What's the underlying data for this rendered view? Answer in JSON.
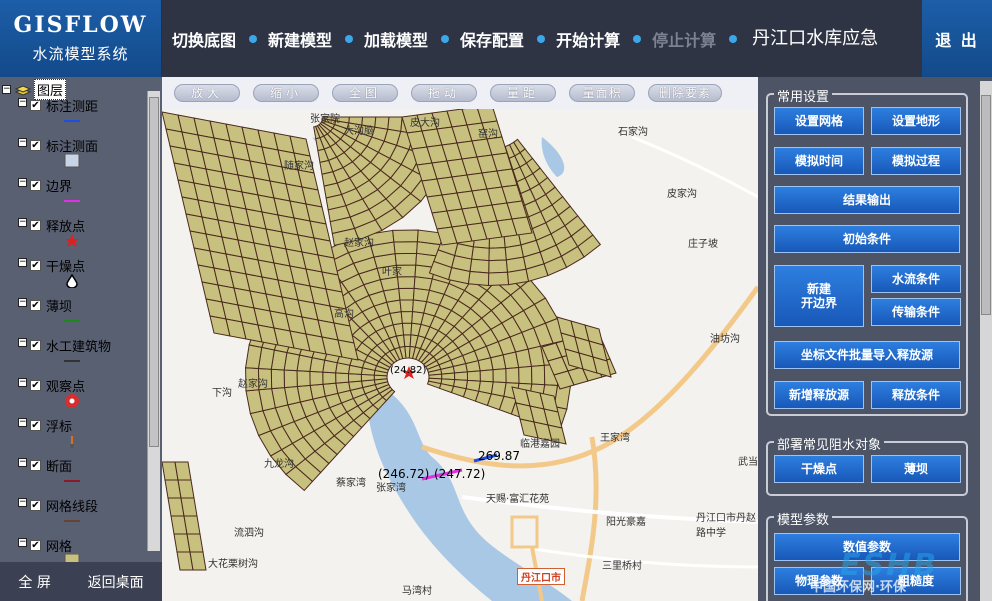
{
  "app": {
    "title": "GISFLOW",
    "subtitle": "水流模型系统"
  },
  "topnav": {
    "items": [
      {
        "label": "切换底图"
      },
      {
        "label": "新建模型"
      },
      {
        "label": "加载模型"
      },
      {
        "label": "保存配置"
      },
      {
        "label": "开始计算"
      },
      {
        "label": "停止计算",
        "disabled": true
      }
    ],
    "project": "丹江口水库应急",
    "exit": "退 出"
  },
  "layers": {
    "root": "图层",
    "items": [
      {
        "label": "标注测距",
        "checked": true,
        "symbol": "blue-line-icon"
      },
      {
        "label": "标注测面",
        "checked": true,
        "symbol": "polygon-swatch-icon"
      },
      {
        "label": "边界",
        "checked": true,
        "symbol": "magenta-line-icon"
      },
      {
        "label": "释放点",
        "checked": true,
        "symbol": "red-star-icon"
      },
      {
        "label": "干燥点",
        "checked": true,
        "symbol": "droplet-icon"
      },
      {
        "label": "薄坝",
        "checked": true,
        "symbol": "green-line-icon"
      },
      {
        "label": "水工建筑物",
        "checked": true,
        "symbol": "dark-line-icon"
      },
      {
        "label": "观察点",
        "checked": true,
        "symbol": "red-pin-icon"
      },
      {
        "label": "浮标",
        "checked": true,
        "symbol": "buoy-icon"
      },
      {
        "label": "断面",
        "checked": true,
        "symbol": "darkred-line-icon"
      },
      {
        "label": "网格线段",
        "checked": true,
        "symbol": "brown-line-icon"
      },
      {
        "label": "网格",
        "checked": true,
        "symbol": "khaki-swatch-icon"
      }
    ],
    "fullscreen": "全  屏",
    "back": "返回桌面"
  },
  "map": {
    "tools": [
      "放大",
      "缩小",
      "全图",
      "拖动",
      "量距",
      "量面积",
      "删除要素"
    ],
    "places": [
      "张家院",
      "大沟脑",
      "皮大沟",
      "窑沟",
      "石家沟",
      "随家沟",
      "皮家沟",
      "赵家沟",
      "庄子坡",
      "叶家",
      "高沟",
      "油坊沟",
      "赵家沟",
      "下沟",
      "王家湾",
      "临港嘉园",
      "九龙沟",
      "武当宫",
      "蔡家湾",
      "张家湾",
      "天赐·富汇花苑",
      "阳光豪嘉",
      "丹江口市丹赵路中学",
      "流泗沟",
      "三里桥村",
      "大花栗树沟",
      "马湾村",
      "丹江口市"
    ],
    "markers": [
      "(24.82)",
      "269.87",
      "(246.72)",
      "(247.72)"
    ]
  },
  "panel": {
    "common": {
      "title": "常用设置",
      "buttons": [
        "设置网格",
        "设置地形",
        "模拟时间",
        "模拟过程",
        "结果输出",
        "初始条件",
        "新建\n开边界",
        "水流条件",
        "传输条件",
        "坐标文件批量导入释放源",
        "新增释放源",
        "释放条件"
      ]
    },
    "obstacles": {
      "title": "部署常见阻水对象",
      "buttons": [
        "干燥点",
        "薄坝"
      ]
    },
    "params": {
      "title": "模型参数",
      "buttons": [
        "数值参数",
        "物理参数",
        "粗糙度"
      ]
    }
  },
  "watermark": {
    "big": "ESHB",
    "small": "中国环保网·环保"
  },
  "colors": {
    "header_blue": "#1c5ea8",
    "accent_dot": "#3ca7e8",
    "grid_fill": "#c8c07e",
    "grid_line": "#4a2a1e",
    "button_blue": "#2069cc"
  }
}
